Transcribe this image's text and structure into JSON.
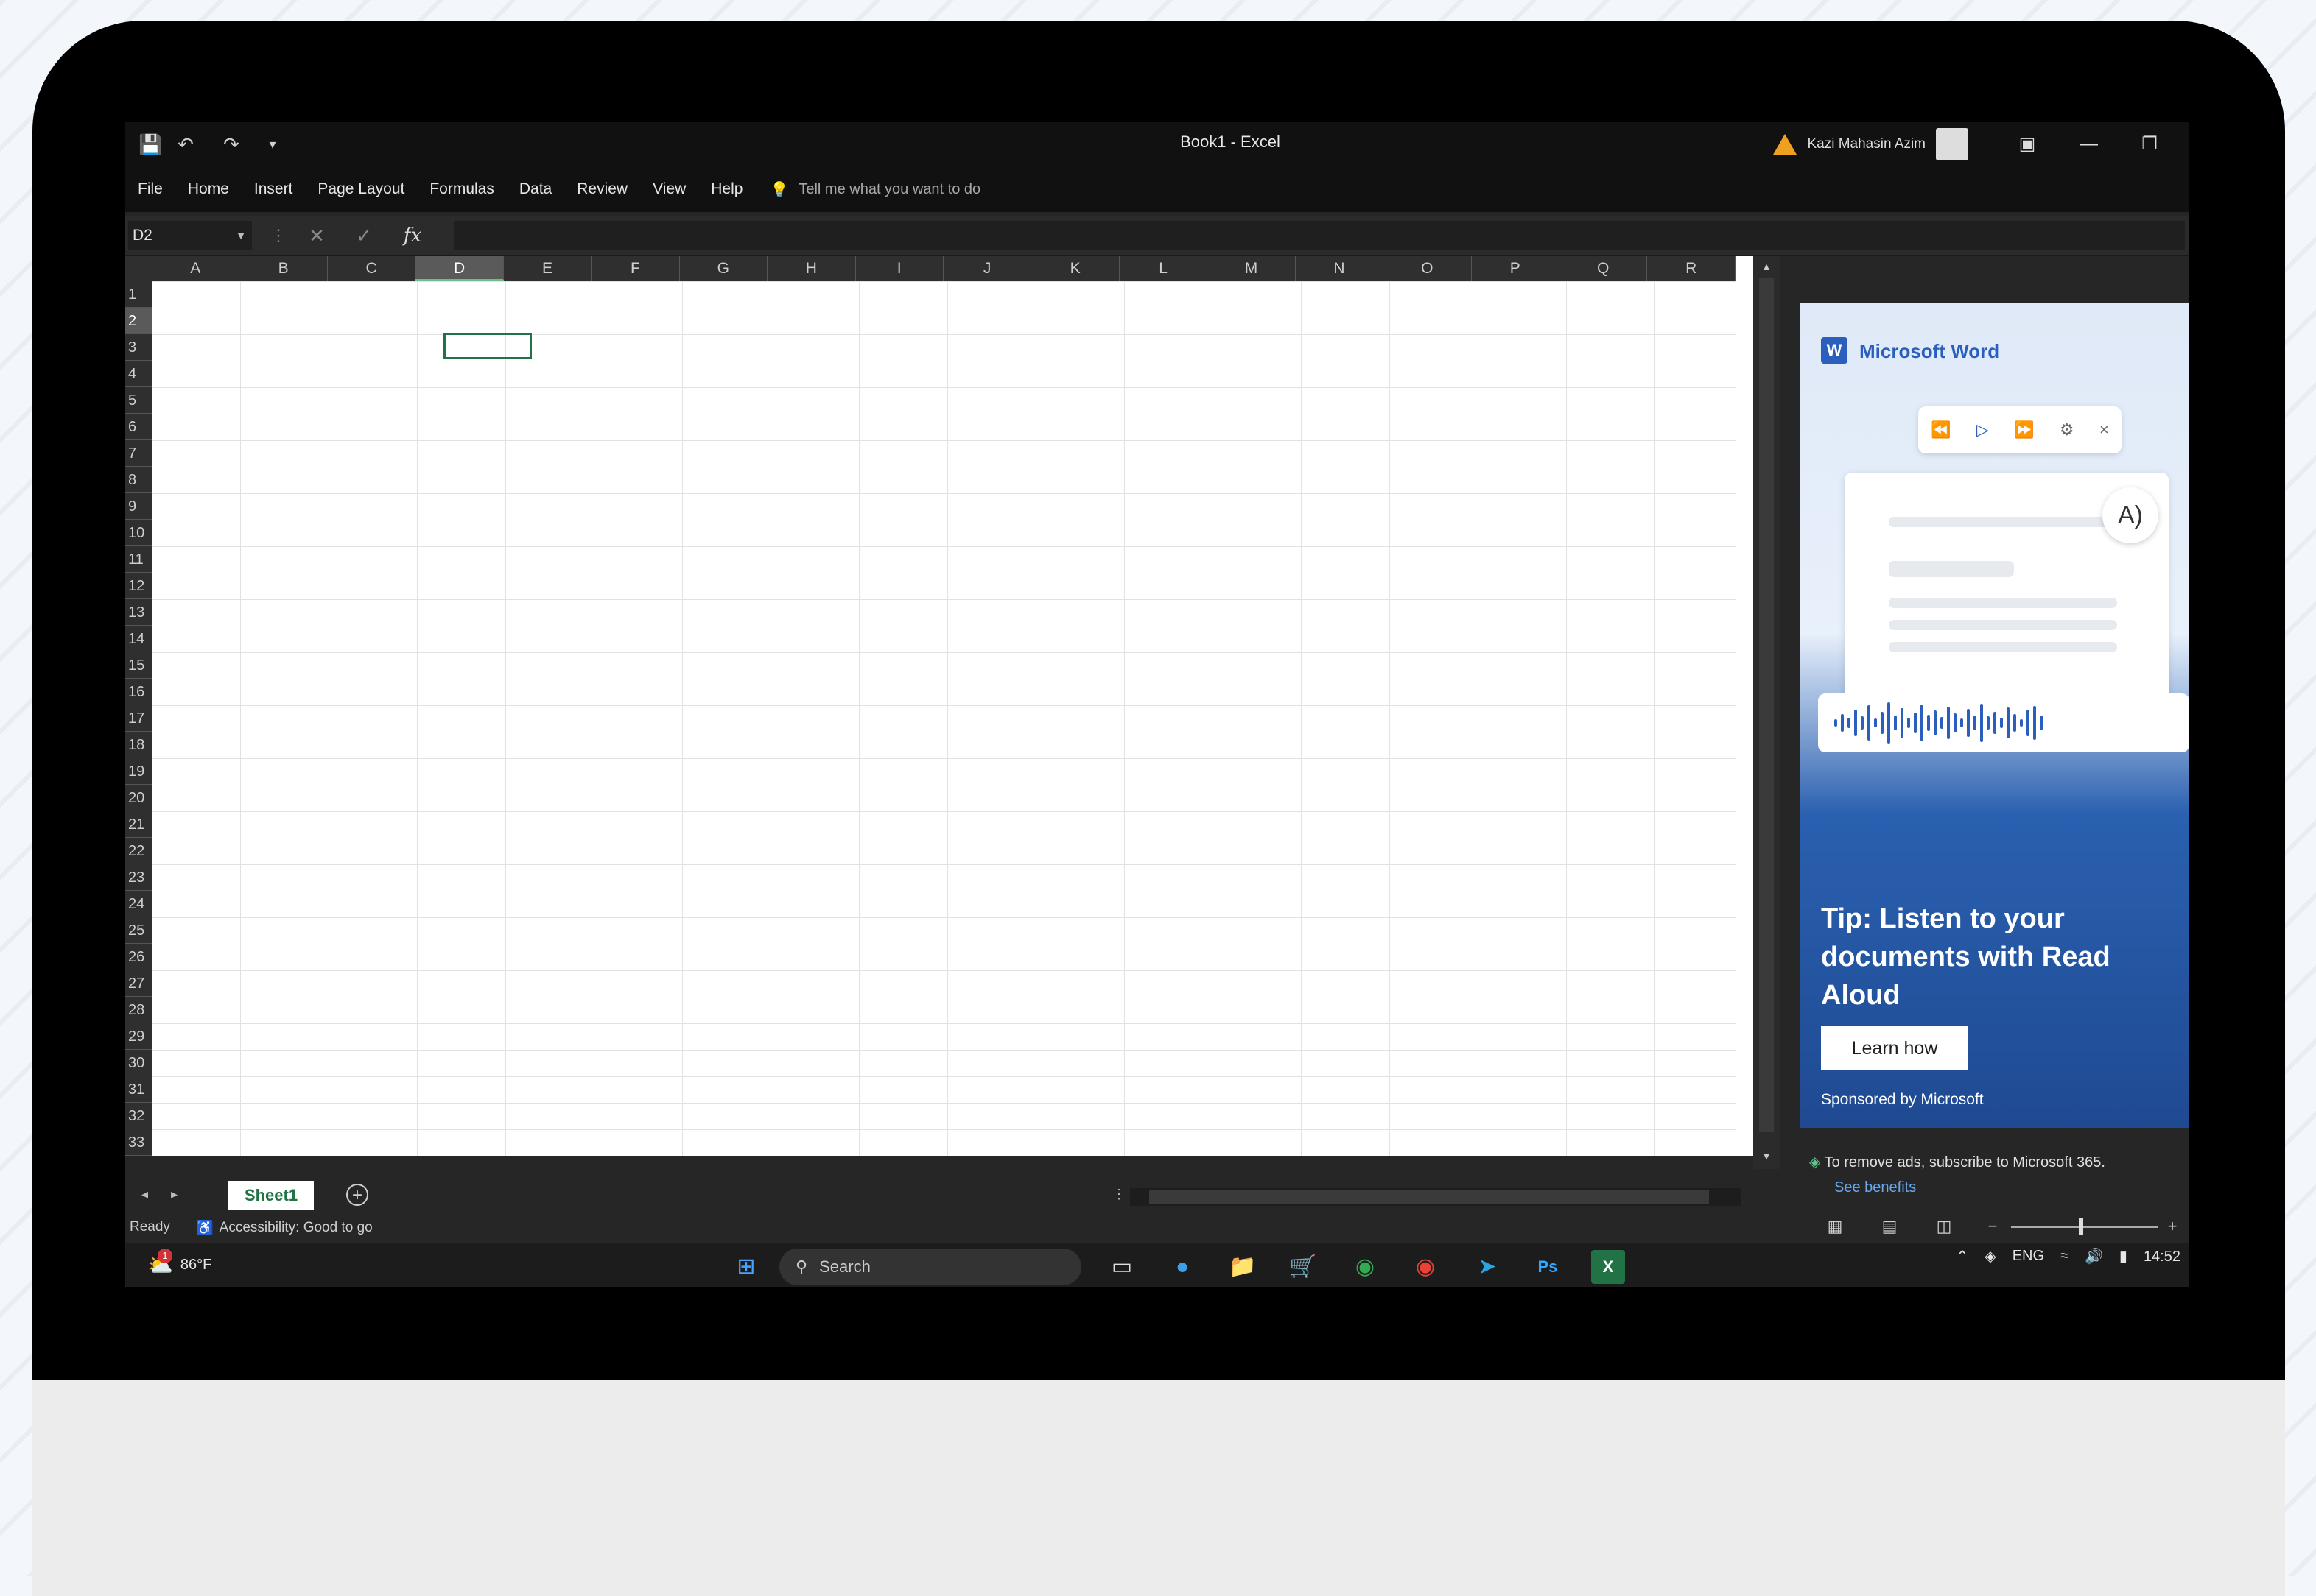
{
  "window": {
    "title": "Book1  -  Excel",
    "user_name": "Kazi Mahasin Azim"
  },
  "menu": {
    "items": [
      "File",
      "Home",
      "Insert",
      "Page Layout",
      "Formulas",
      "Data",
      "Review",
      "View",
      "Help"
    ],
    "tell_me": "Tell me what you want to do"
  },
  "formula_bar": {
    "name_box": "D2",
    "function_symbol": "fx"
  },
  "grid": {
    "columns": [
      "A",
      "B",
      "C",
      "D",
      "E",
      "F",
      "G",
      "H",
      "I",
      "J",
      "K",
      "L",
      "M",
      "N",
      "O",
      "P",
      "Q",
      "R"
    ],
    "selected_column": "D",
    "rows": [
      "1",
      "2",
      "3",
      "4",
      "5",
      "6",
      "7",
      "8",
      "9",
      "10",
      "11",
      "12",
      "13",
      "14",
      "15",
      "16",
      "17",
      "18",
      "19",
      "20",
      "21",
      "22",
      "23",
      "24",
      "25",
      "26",
      "27",
      "28",
      "29",
      "30",
      "31",
      "32",
      "33"
    ],
    "selected_row": "2",
    "active_cell": "D2"
  },
  "sheets": {
    "tabs": [
      "Sheet1"
    ]
  },
  "status": {
    "ready": "Ready",
    "accessibility": "Accessibility: Good to go"
  },
  "taskbar": {
    "weather": "86°F",
    "weather_badge": "1",
    "search_placeholder": "Search",
    "language": "ENG",
    "time": "14:52"
  },
  "ad": {
    "product": "Microsoft Word",
    "tip": "Tip: Listen to your documents with Read Aloud",
    "button": "Learn how",
    "sponsor": "Sponsored by Microsoft",
    "remove_text": "To remove ads, subscribe to Microsoft 365.",
    "benefits_link": "See benefits"
  },
  "colors": {
    "excel_green": "#217346",
    "ad_blue": "#2b5fbe"
  }
}
